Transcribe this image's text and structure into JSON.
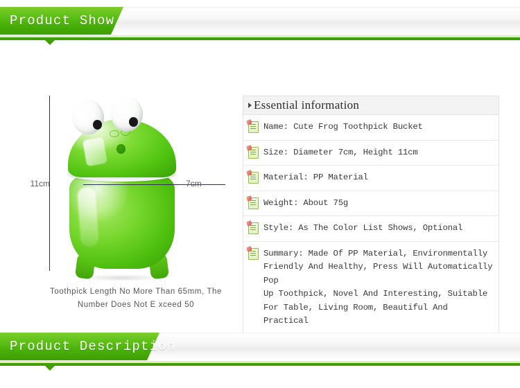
{
  "banners": {
    "top": {
      "label": "Product Show"
    },
    "bottom": {
      "label": "Product Description"
    }
  },
  "product_photo": {
    "height_label": "11cm",
    "width_label": "7cm",
    "caption": "Toothpick Length No More Than 65mm,\nThe Number Does Not E  xceed 50",
    "alt": "Green cute frog toothpick bucket"
  },
  "info_panel": {
    "header": "Essential information",
    "rows": [
      {
        "icon": "note-document-icon",
        "text": "Name: Cute Frog Toothpick Bucket"
      },
      {
        "icon": "note-document-icon",
        "text": "Size: Diameter 7cm, Height 11cm"
      },
      {
        "icon": "note-document-icon",
        "text": "Material: PP Material"
      },
      {
        "icon": "note-document-icon",
        "text": "Weight: About 75g"
      },
      {
        "icon": "note-document-icon",
        "text": "Style: As The Color List Shows, Optional"
      },
      {
        "icon": "note-document-icon",
        "text": "Summary: Made Of PP Material, Environmentally\nFriendly And Healthy, Press Will Automatically Pop\nUp Toothpick, Novel And Interesting, Suitable\nFor Table, Living Room, Beautiful And Practical"
      }
    ]
  },
  "colors": {
    "brand_green": "#4cbe0d",
    "banner_green_dark": "#3f9f07",
    "banner_green_light": "#7ace2b",
    "guide_line": "#2a3446",
    "body_text": "#3a3a3a"
  }
}
